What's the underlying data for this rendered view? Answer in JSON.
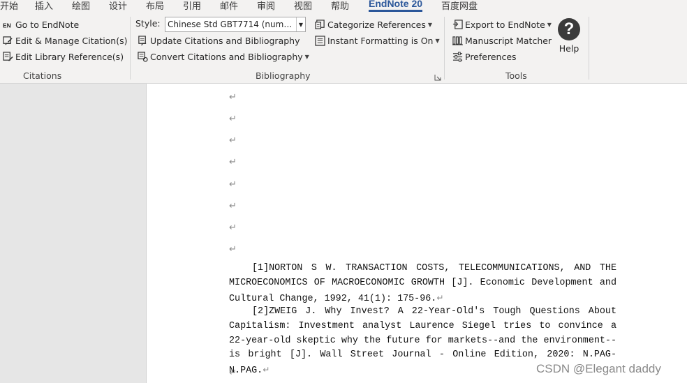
{
  "tabs": [
    {
      "label": "开始"
    },
    {
      "label": "插入"
    },
    {
      "label": "绘图"
    },
    {
      "label": "设计"
    },
    {
      "label": "布局"
    },
    {
      "label": "引用"
    },
    {
      "label": "邮件"
    },
    {
      "label": "审阅"
    },
    {
      "label": "视图"
    },
    {
      "label": "帮助"
    },
    {
      "label": "EndNote 20",
      "active": true
    },
    {
      "label": "百度网盘"
    }
  ],
  "citations_group": {
    "label": "Citations",
    "buttons": [
      {
        "label": "Go to EndNote",
        "icon": "endnote-en-icon"
      },
      {
        "label": "Edit & Manage Citation(s)",
        "icon": "edit-citation-icon"
      },
      {
        "label": "Edit Library Reference(s)",
        "icon": "edit-library-icon"
      }
    ]
  },
  "bibliography_group": {
    "label": "Bibliography",
    "style_label": "Style:",
    "style_value": "Chinese Std GBT7714 (numer...",
    "buttons": [
      {
        "label": "Update Citations and Bibliography",
        "icon": "update-icon"
      },
      {
        "label": "Convert Citations and Bibliography",
        "icon": "convert-icon"
      },
      {
        "label": "Categorize References",
        "icon": "categorize-icon"
      },
      {
        "label": "Instant Formatting is On",
        "icon": "instant-format-icon"
      }
    ]
  },
  "tools_group": {
    "label": "Tools",
    "buttons": [
      {
        "label": "Export to EndNote",
        "icon": "export-icon"
      },
      {
        "label": "Manuscript Matcher",
        "icon": "manuscript-matcher-icon"
      },
      {
        "label": "Preferences",
        "icon": "preferences-icon"
      }
    ],
    "help_label": "Help",
    "help_glyph": "?"
  },
  "document": {
    "paragraph_mark": "↵",
    "references": [
      "[1]NORTON S W. TRANSACTION COSTS, TELECOMMUNICATIONS, AND THE MICROECONOMICS OF MACROECONOMIC GROWTH [J]. Economic Development and Cultural Change, 1992, 41(1): 175-96.",
      "[2]ZWEIG J. Why Invest? A 22-Year-Old's Tough Questions About Capitalism: Investment analyst Laurence Siegel tries to convince a 22-year-old skeptic why the future for markets--and the environment--is bright [J]. Wall Street Journal - Online Edition, 2020: N.PAG-N.PAG."
    ]
  },
  "watermark": "CSDN @Elegant  daddy",
  "colors": {
    "accent": "#2b579a",
    "ribbon_bg": "#f3f2f1",
    "page_bg": "#ffffff",
    "pane_bg": "#e6e6e6"
  }
}
